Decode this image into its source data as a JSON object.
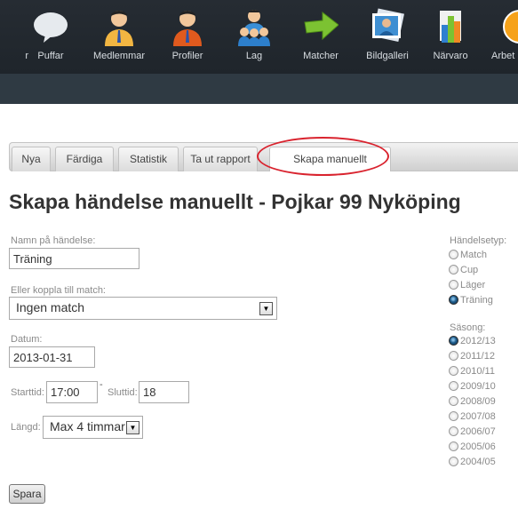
{
  "nav": {
    "items": [
      {
        "label": "r",
        "icon": "unknown-icon"
      },
      {
        "label": "Puffar",
        "icon": "speech-bubble-icon"
      },
      {
        "label": "Medlemmar",
        "icon": "member-icon"
      },
      {
        "label": "Profiler",
        "icon": "profile-icon"
      },
      {
        "label": "Lag",
        "icon": "team-icon"
      },
      {
        "label": "Matcher",
        "icon": "arrow-right-icon"
      },
      {
        "label": "Bildgalleri",
        "icon": "photo-gallery-icon"
      },
      {
        "label": "Närvaro",
        "icon": "bar-chart-icon"
      },
      {
        "label": "Arbet",
        "icon": "warning-icon"
      }
    ]
  },
  "tabs": [
    {
      "label": "Nya"
    },
    {
      "label": "Färdiga"
    },
    {
      "label": "Statistik"
    },
    {
      "label": "Ta ut rapport"
    },
    {
      "label": "Skapa manuellt",
      "active": true
    }
  ],
  "highlight_color": "#d9232e",
  "page_title": "Skapa händelse manuellt - Pojkar 99 Nyköping",
  "form": {
    "name_label": "Namn på händelse:",
    "name_value": "Träning",
    "match_label": "Eller koppla till match:",
    "match_value": "Ingen match",
    "date_label": "Datum:",
    "date_value": "2013-01-31",
    "start_label": "Starttid:",
    "start_value": "17:00",
    "dash": "-",
    "end_label": "Sluttid:",
    "end_value": "18",
    "length_label": "Längd:",
    "length_value": "Max 4 timmar",
    "save_label": "Spara"
  },
  "event_type": {
    "label": "Händelsetyp:",
    "options": [
      "Match",
      "Cup",
      "Läger",
      "Träning"
    ],
    "selected": "Träning"
  },
  "season": {
    "label": "Säsong:",
    "options": [
      "2012/13",
      "2011/12",
      "2010/11",
      "2009/10",
      "2008/09",
      "2007/08",
      "2006/07",
      "2005/06",
      "2004/05"
    ],
    "selected": "2012/13"
  }
}
